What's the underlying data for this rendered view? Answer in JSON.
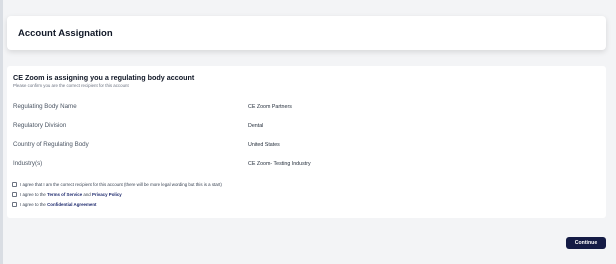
{
  "header": {
    "title": "Account Assignation"
  },
  "assignment": {
    "title": "CE Zoom is assigning you a regulating body account",
    "subtitle": "Please confirm you are the correct recipient for this account",
    "fields": [
      {
        "label": "Regulating Body Name",
        "value": "CE Zoom Partners"
      },
      {
        "label": "Regulatory Division",
        "value": "Dental"
      },
      {
        "label": "Country of Regulating Body",
        "value": "United States"
      },
      {
        "label": "Industry(s)",
        "value": "CE Zoom- Testing Industry"
      }
    ]
  },
  "agreements": {
    "recipient": {
      "text": "I agree that I am the correct recipient for this account (there will be more legal wording but this is a start)",
      "checked": false
    },
    "terms": {
      "prefix": "I agree to the ",
      "link1": "Terms of Service",
      "middle": " and ",
      "link2": "Privacy Policy",
      "checked": false
    },
    "confidential": {
      "prefix": "I agree to the ",
      "link": "Confidential Agreement",
      "checked": false
    }
  },
  "actions": {
    "continue_label": "Continue"
  },
  "colors": {
    "primary": "#141b45",
    "link": "#1e2a6e",
    "background": "#f3f4f6"
  }
}
